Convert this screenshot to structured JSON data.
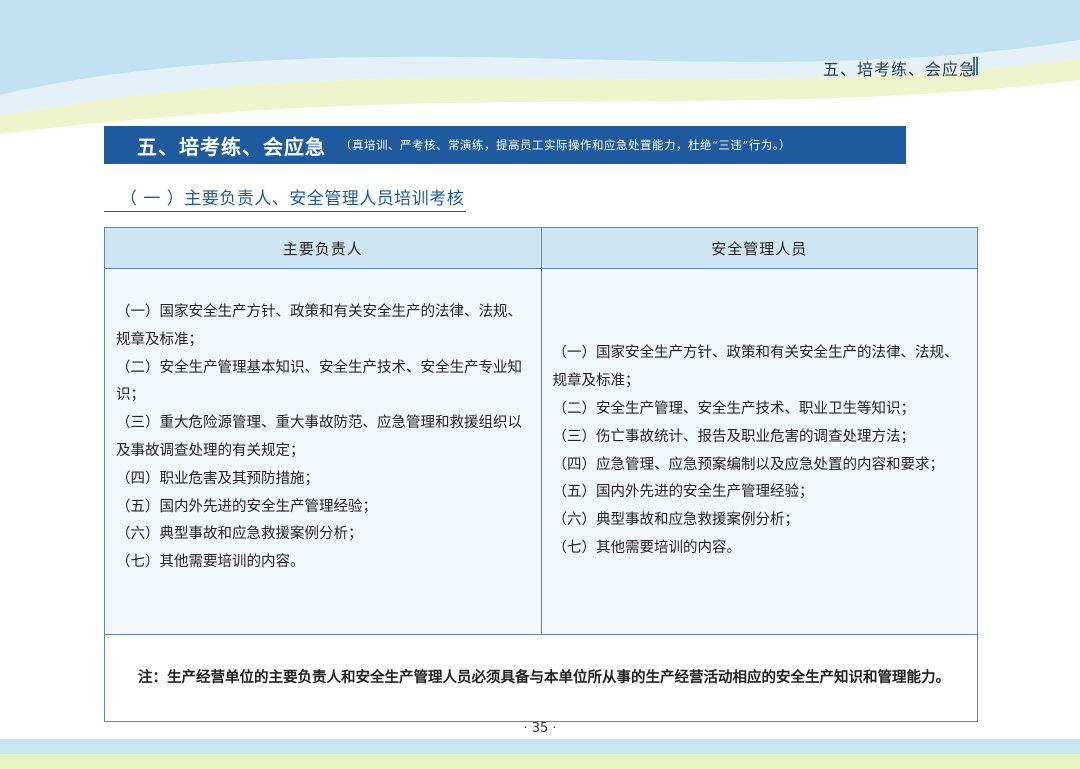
{
  "header": {
    "tag": "五、培考练、会应急"
  },
  "section": {
    "title": "五、培考练、会应急",
    "subtitle": "（真培训、严考核、常演练，提高员工实际操作和应急处置能力，杜绝“三违”行为。）"
  },
  "subsection": {
    "title": "（ 一 ）主要负责人、安全管理人员培训考核"
  },
  "table": {
    "headers": [
      "主要负责人",
      "安全管理人员"
    ],
    "left_items": [
      "（一）国家安全生产方针、政策和有关安全生产的法律、法规、规章及标准；",
      "（二）安全生产管理基本知识、安全生产技术、安全生产专业知识；",
      "（三）重大危险源管理、重大事故防范、应急管理和救援组织以及事故调查处理的有关规定；",
      "（四）职业危害及其预防措施；",
      "（五）国内外先进的安全生产管理经验；",
      "（六）典型事故和应急救援案例分析；",
      "（七）其他需要培训的内容。"
    ],
    "right_items": [
      "（一）国家安全生产方针、政策和有关安全生产的法律、法规、规章及标准；",
      "（二）安全生产管理、安全生产技术、职业卫生等知识；",
      "（三）伤亡事故统计、报告及职业危害的调查处理方法；",
      "（四）应急管理、应急预案编制以及应急处置的内容和要求；",
      "（五）国内外先进的安全生产管理经验；",
      "（六）典型事故和应急救援案例分析；",
      "（七）其他需要培训的内容。"
    ],
    "note_label": "注：",
    "note_text": "生产经营单位的主要负责人和安全生产管理人员必须具备与本单位所从事的生产经营活动相应的安全生产知识和管理能力。"
  },
  "page_number": "· 35 ·",
  "colors": {
    "title_bar": "#1d5a9e",
    "header_cell": "#cfe6f5",
    "content_cell": "#f2f9fc",
    "border": "#5b86b8",
    "wave_blue": "#bfe0f1",
    "wave_green": "#eef5c8"
  }
}
